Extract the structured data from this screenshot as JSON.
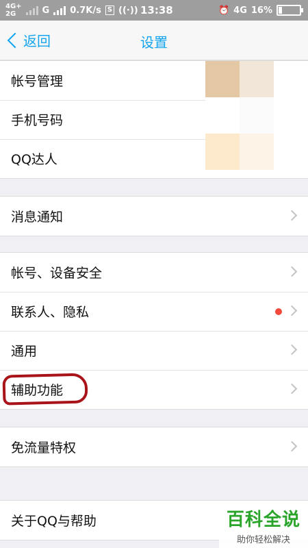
{
  "status_bar": {
    "net_top": "4G+",
    "net_bottom": "2G",
    "carrier_g": "G",
    "speed": "0.7K/s",
    "s_badge": "S",
    "time": "13:38",
    "net_right": "4G",
    "battery_text": "16%",
    "battery_level": 0.16,
    "icons": [
      "signal-icon",
      "hotspot-icon",
      "alarm-icon",
      "battery-icon"
    ]
  },
  "nav": {
    "back_label": "返回",
    "title": "设置"
  },
  "groups": [
    {
      "items": [
        {
          "label": "帐号管理"
        },
        {
          "label": "手机号码"
        },
        {
          "label": "QQ达人"
        }
      ]
    },
    {
      "items": [
        {
          "label": "消息通知"
        }
      ]
    },
    {
      "items": [
        {
          "label": "帐号、设备安全"
        },
        {
          "label": "联系人、隐私"
        },
        {
          "label": "通用"
        },
        {
          "label": "辅助功能"
        }
      ]
    },
    {
      "items": [
        {
          "label": "免流量特权"
        }
      ]
    },
    {
      "items": [
        {
          "label": "关于QQ与帮助"
        }
      ]
    }
  ],
  "colors": {
    "accent": "#12a4ee",
    "red_dot": "#f2493c",
    "highlight": "#a8141a",
    "mosaic": [
      "#e4c8a6",
      "#f2e6d8",
      "#ffffff",
      "#ffffff",
      "#fbfbfb",
      "#ffffff",
      "#fde9cc",
      "#fdf3e6",
      "#ffffff"
    ]
  },
  "watermark": {
    "main": "百科全说",
    "sub": "助你轻松解决"
  }
}
